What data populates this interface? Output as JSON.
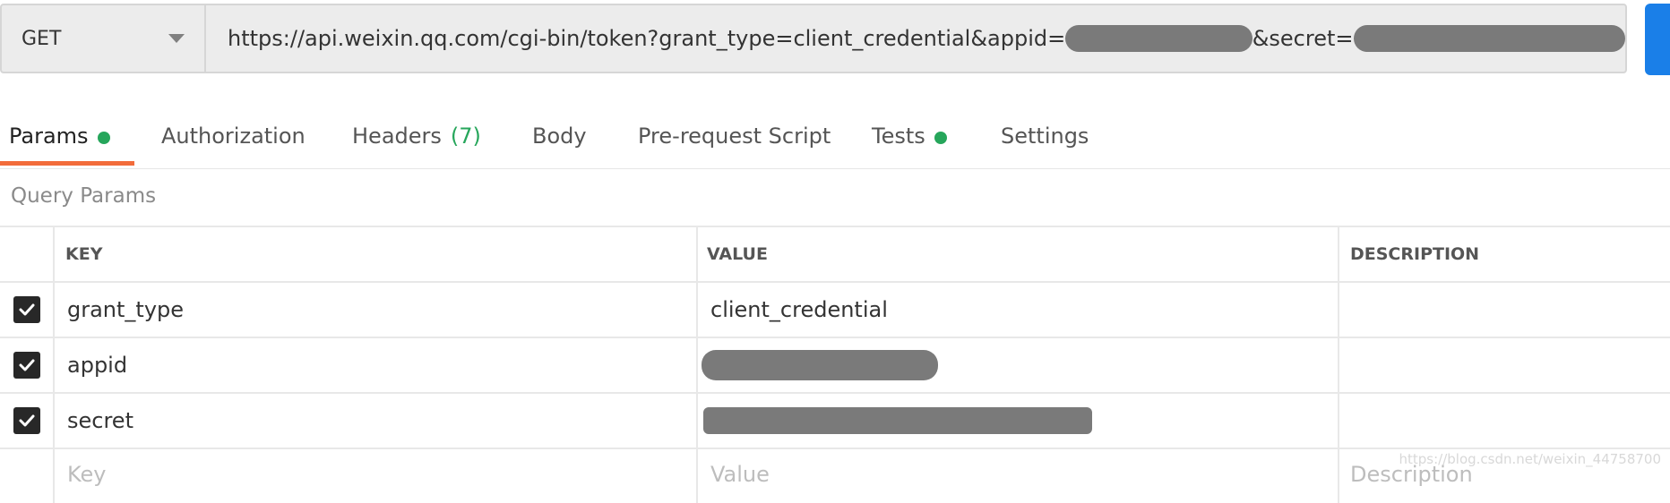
{
  "request": {
    "method": "GET",
    "url_base": "https://api.weixin.qq.com/cgi-bin/token?grant_type=client_credential&appid=",
    "url_secret_label": "&secret="
  },
  "tabs": [
    {
      "label": "Params",
      "dot": true
    },
    {
      "label": "Authorization"
    },
    {
      "label": "Headers",
      "count": "(7)"
    },
    {
      "label": "Body"
    },
    {
      "label": "Pre-request Script"
    },
    {
      "label": "Tests",
      "dot": true
    },
    {
      "label": "Settings"
    }
  ],
  "query_params": {
    "title": "Query Params",
    "headers": {
      "key": "KEY",
      "value": "VALUE",
      "description": "DESCRIPTION"
    },
    "rows": [
      {
        "key": "grant_type",
        "value": "client_credential",
        "checked": true
      },
      {
        "key": "appid",
        "value": "",
        "checked": true
      },
      {
        "key": "secret",
        "value": "",
        "checked": true
      }
    ],
    "placeholders": {
      "key": "Key",
      "value": "Value",
      "description": "Description"
    }
  },
  "watermark": "https://blog.csdn.net/weixin_44758700",
  "colors": {
    "accent_tab": "#f26b3a",
    "status_dot": "#26a65b",
    "send_button": "#1a7fe8"
  }
}
